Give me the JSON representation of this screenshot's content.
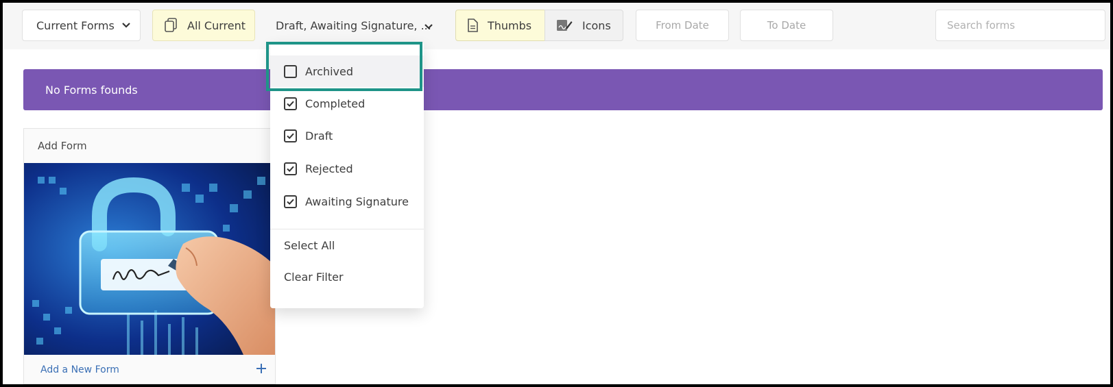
{
  "toolbar": {
    "forms_select": "Current Forms",
    "all_current": "All Current",
    "status_filter": "Draft, Awaiting Signature, ...",
    "thumbs": "Thumbs",
    "icons": "Icons",
    "from_date": "From Date",
    "to_date": "To Date",
    "search_placeholder": "Search forms"
  },
  "banner": {
    "message": "No Forms founds",
    "color": "#7a57b3"
  },
  "card": {
    "title": "Add Form",
    "footer_link": "Add a New Form"
  },
  "status_menu": {
    "options": [
      {
        "label": "Archived",
        "checked": false
      },
      {
        "label": "Completed",
        "checked": true
      },
      {
        "label": "Draft",
        "checked": true
      },
      {
        "label": "Rejected",
        "checked": true
      },
      {
        "label": "Awaiting Signature",
        "checked": true
      }
    ],
    "select_all": "Select All",
    "clear_filter": "Clear Filter"
  },
  "colors": {
    "highlight_box": "#1e9488",
    "link": "#3a6fb5"
  }
}
